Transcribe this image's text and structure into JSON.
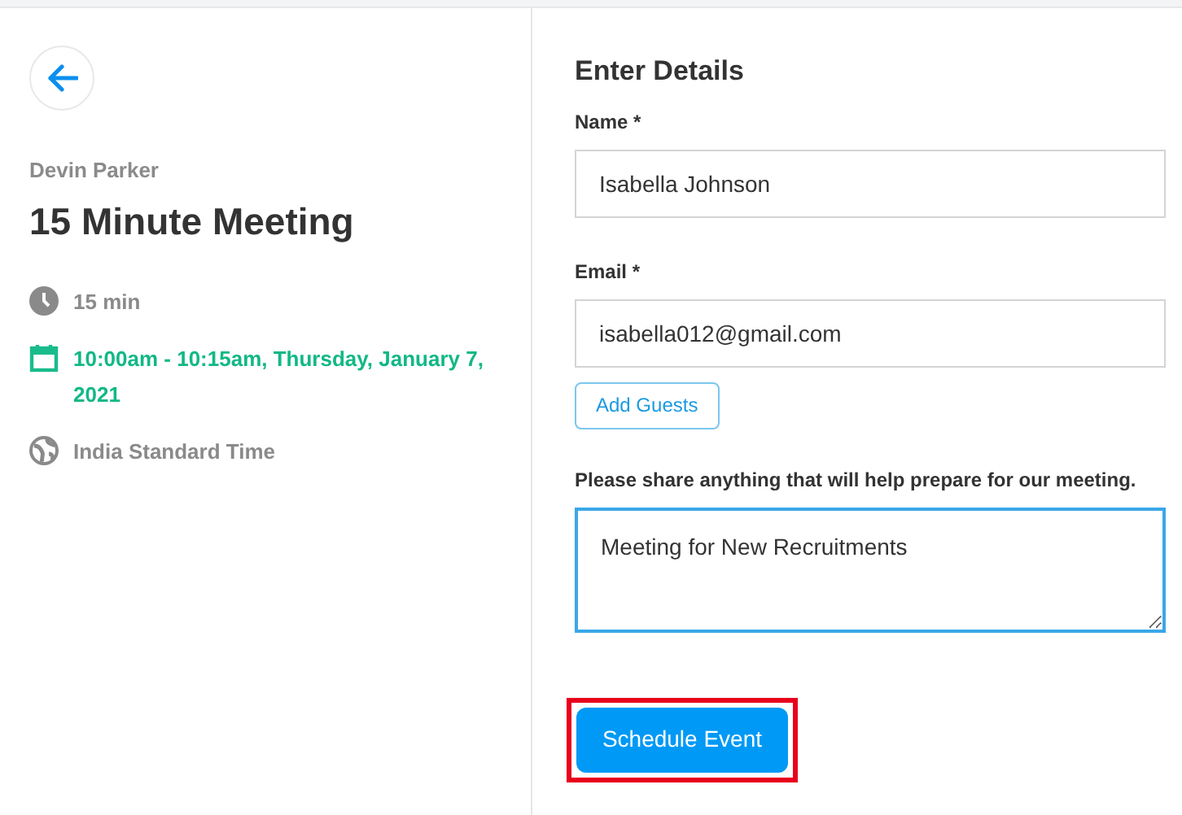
{
  "event": {
    "organizer": "Devin Parker",
    "title": "15 Minute Meeting",
    "details": [
      {
        "kind": "duration",
        "text": "15 min"
      },
      {
        "kind": "time",
        "text": "10:00am - 10:15am, Thursday, January 7, 2021"
      },
      {
        "kind": "timezone",
        "text": "India Standard Time"
      }
    ]
  },
  "form": {
    "heading": "Enter Details",
    "fields": [
      {
        "label": "Name *",
        "value": "Isabella Johnson"
      },
      {
        "label": "Email *",
        "value": "isabella012@gmail.com"
      }
    ],
    "add_guests": "Add Guests",
    "notes": {
      "label": "Please share anything that will help prepare for our meeting.",
      "value": "Meeting for New Recruitments",
      "focused": true
    },
    "submit": {
      "label": "Schedule Event",
      "highlighted": true
    }
  }
}
